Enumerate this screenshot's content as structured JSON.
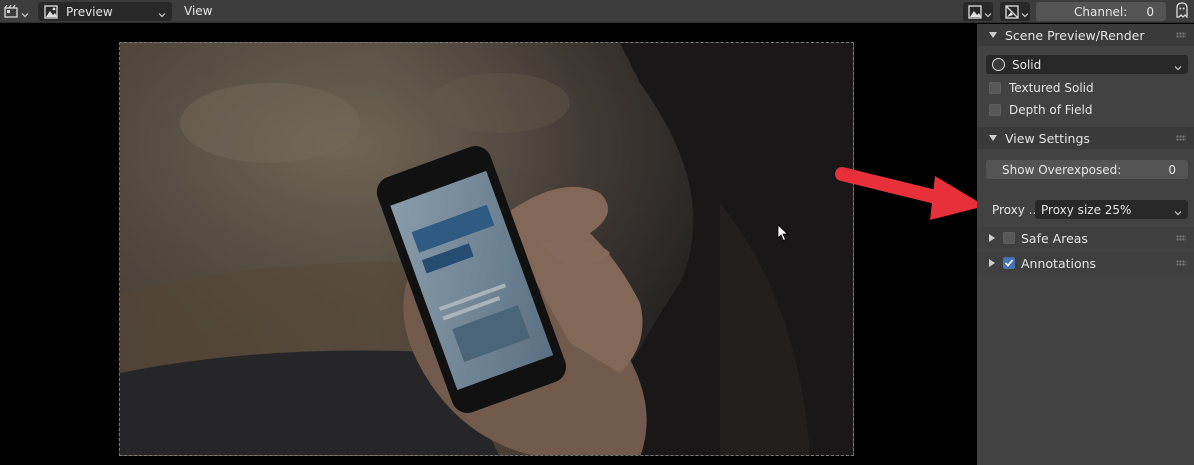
{
  "header": {
    "editor_type_icon": "sequencer-icon",
    "view_type": {
      "icon": "image-preview-icon",
      "label": "Preview"
    },
    "menu_view": "View",
    "overlay_icon": "image-overlay-icon",
    "gizmo_icon": "display-mode-icon",
    "channel": {
      "label": "Channel:",
      "value": "0"
    },
    "ghost_icon": "ghost-icon"
  },
  "sidebar": {
    "scene_panel": {
      "title": "Scene Preview/Render",
      "shading": {
        "icon": "solid-sphere-icon",
        "value": "Solid"
      },
      "textured_solid": {
        "label": "Textured Solid",
        "checked": false
      },
      "depth_of_field": {
        "label": "Depth of Field",
        "checked": false
      }
    },
    "view_panel": {
      "title": "View Settings",
      "show_overexposed": {
        "label": "Show Overexposed:",
        "value": "0"
      },
      "proxy": {
        "label": "Proxy ..",
        "value": "Proxy size 25%"
      }
    },
    "safe_areas": {
      "label": "Safe Areas",
      "checked": false
    },
    "annotations": {
      "label": "Annotations",
      "checked": true
    }
  },
  "colors": {
    "header_bg": "#3d3d3d",
    "sidebar_bg": "#424242",
    "accent_blue": "#4772b3",
    "annotation_arrow": "#e8303a"
  }
}
